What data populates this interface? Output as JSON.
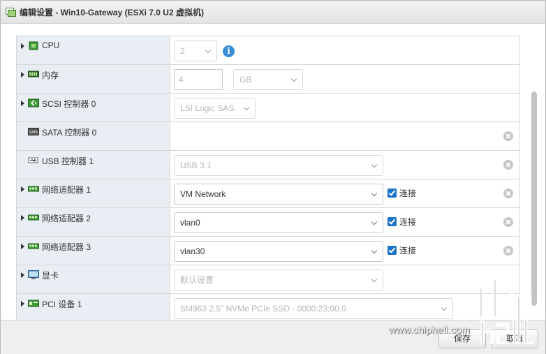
{
  "window": {
    "title": "编辑设置 - Win10-Gateway (ESXi 7.0 U2 虚拟机)"
  },
  "rows": [
    {
      "label": "CPU",
      "icon": "cpu-icon",
      "expandable": true,
      "control": {
        "type": "select",
        "value": "2",
        "disabled": true
      },
      "info": "i"
    },
    {
      "label": "内存",
      "icon": "memory-icon",
      "expandable": true,
      "control": {
        "type": "input",
        "value": "4",
        "unit": "GB"
      }
    },
    {
      "label": "SCSI 控制器 0",
      "icon": "scsi-controller-icon",
      "expandable": true,
      "control": {
        "type": "select",
        "value": "LSI Logic SAS",
        "disabled": true
      }
    },
    {
      "label": "SATA 控制器 0",
      "icon": "sata-controller-icon",
      "expandable": false,
      "removable": true
    },
    {
      "label": "USB 控制器 1",
      "icon": "usb-controller-icon",
      "expandable": false,
      "control": {
        "type": "select",
        "value": "USB 3.1",
        "disabled": true
      },
      "removable": true
    },
    {
      "label": "网络适配器 1",
      "icon": "network-adapter-icon",
      "expandable": true,
      "control": {
        "type": "select",
        "value": "VM Network",
        "disabled": false
      },
      "connect": {
        "checked": true,
        "label": "连接"
      },
      "removable": true
    },
    {
      "label": "网络适配器 2",
      "icon": "network-adapter-icon",
      "expandable": true,
      "control": {
        "type": "select",
        "value": "vlan0",
        "disabled": false
      },
      "connect": {
        "checked": true,
        "label": "连接"
      },
      "removable": true
    },
    {
      "label": "网络适配器 3",
      "icon": "network-adapter-icon",
      "expandable": true,
      "control": {
        "type": "select",
        "value": "vlan30",
        "disabled": false
      },
      "connect": {
        "checked": true,
        "label": "连接"
      },
      "removable": true
    },
    {
      "label": "显卡",
      "icon": "display-icon",
      "expandable": true,
      "control": {
        "type": "select",
        "value": "默认设置",
        "disabled": true
      }
    },
    {
      "label": "PCI 设备 1",
      "icon": "pci-device-icon",
      "expandable": true,
      "control": {
        "type": "select",
        "value": "SM963 2.5\" NVMe PCIe SSD - 0000:23:00.0",
        "disabled": true
      }
    }
  ],
  "footer": {
    "save_label": "保存",
    "cancel_label": "取消"
  },
  "watermark": {
    "text": "www.chiphell.com"
  },
  "colors": {
    "label_bg": "#e8eef3",
    "checkbox": "#1a73c8",
    "info": "#3a8fd6"
  }
}
